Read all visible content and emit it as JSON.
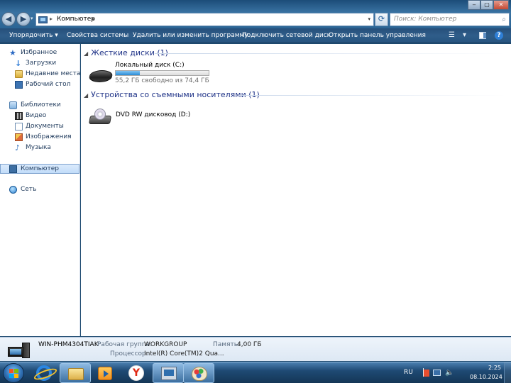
{
  "address": {
    "location": "Компьютер",
    "separator": "▸",
    "search_placeholder": "Поиск: Компьютер"
  },
  "window_buttons": {
    "minimize": "‒",
    "maximize": "▢",
    "close": "✕"
  },
  "toolbar": {
    "organize": "Упорядочить ▾",
    "system_props": "Свойства системы",
    "uninstall": "Удалить или изменить программу",
    "map_drive": "Подключить сетевой диск",
    "control_panel": "Открыть панель управления"
  },
  "nav": {
    "favorites": "Избранное",
    "downloads": "Загрузки",
    "recent": "Недавние места",
    "desktop": "Рабочий стол",
    "libraries": "Библиотеки",
    "video": "Видео",
    "documents": "Документы",
    "images": "Изображения",
    "music": "Музыка",
    "computer": "Компьютер",
    "network": "Сеть"
  },
  "content": {
    "hdd_group": "Жесткие диски (1)",
    "drive_c": {
      "label": "Локальный диск (C:)",
      "free_text": "55,2 ГБ свободно из 74,4 ГБ",
      "used_fraction": 0.26
    },
    "removable_group": "Устройства со съемными носителями (1)",
    "drive_d": {
      "label": "DVD RW дисковод (D:)"
    }
  },
  "details": {
    "computer_name": "WIN-PHM4304TIAK",
    "workgroup_key": "Рабочая группа:",
    "workgroup_val": "WORKGROUP",
    "memory_key": "Память:",
    "memory_val": "4,00 ГБ",
    "cpu_key": "Процессор:",
    "cpu_val": "Intel(R) Core(TM)2 Qua..."
  },
  "tray": {
    "language": "RU",
    "time": "2:25",
    "date": "08.10.2024"
  },
  "colors": {
    "accent": "#1e3287",
    "progress": "#2a8bd6",
    "taskbar": "#1f4a74"
  }
}
